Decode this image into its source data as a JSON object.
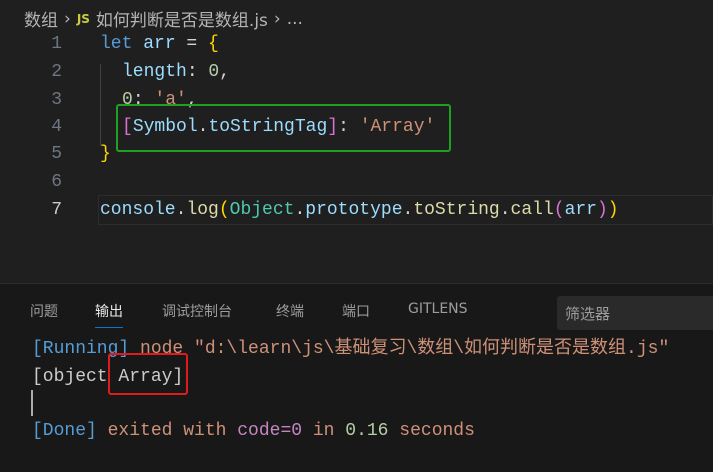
{
  "breadcrumb": {
    "folder": "数组",
    "file_icon": "JS",
    "file": "如何判断是否是数组.js",
    "more": "..."
  },
  "editor": {
    "line_numbers": [
      "1",
      "2",
      "3",
      "4",
      "5",
      "6",
      "7"
    ],
    "current_line": 7,
    "lines": {
      "l1": {
        "kw": "let",
        "var": "arr",
        "op": " = ",
        "brace": "{"
      },
      "l2": {
        "prop": "length",
        "colon": ": ",
        "num": "0",
        "comma": ","
      },
      "l3": {
        "num": "0",
        "colon": ": ",
        "str": "'a'",
        "comma": ","
      },
      "l4": {
        "lb": "[",
        "obj": "Symbol",
        "dot": ".",
        "prop": "toStringTag",
        "rb": "]",
        "colon": ": ",
        "str": "'Array'"
      },
      "l5": {
        "brace": "}"
      },
      "l7": {
        "obj": "console",
        "dot": ".",
        "fn": "log",
        "lp": "(",
        "cls": "Object",
        "p1": ".",
        "proto": "prototype",
        "p2": ".",
        "fn2": "toString",
        "p3": ".",
        "fn3": "call",
        "lp2": "(",
        "arg": "arr",
        "rp2": ")",
        "rp": ")"
      }
    }
  },
  "panel": {
    "tabs": [
      "问题",
      "输出",
      "调试控制台",
      "终端",
      "端口",
      "GITLENS"
    ],
    "active_tab": "输出",
    "filter_placeholder": "筛选器",
    "output": {
      "running": "[Running]",
      "command": " node \"d:\\learn\\js\\基础复习\\数组\\如何判断是否是数组.js\"",
      "result_pre": "[object ",
      "result_hl": "Array",
      "result_post": "]",
      "done": "[Done]",
      "exited": " exited with ",
      "code": "code=0",
      "in": " in ",
      "time": "0.16",
      "seconds": " seconds"
    }
  },
  "highlights": {
    "green_box": "#1ea11e",
    "red_box": "#e01b1b"
  }
}
